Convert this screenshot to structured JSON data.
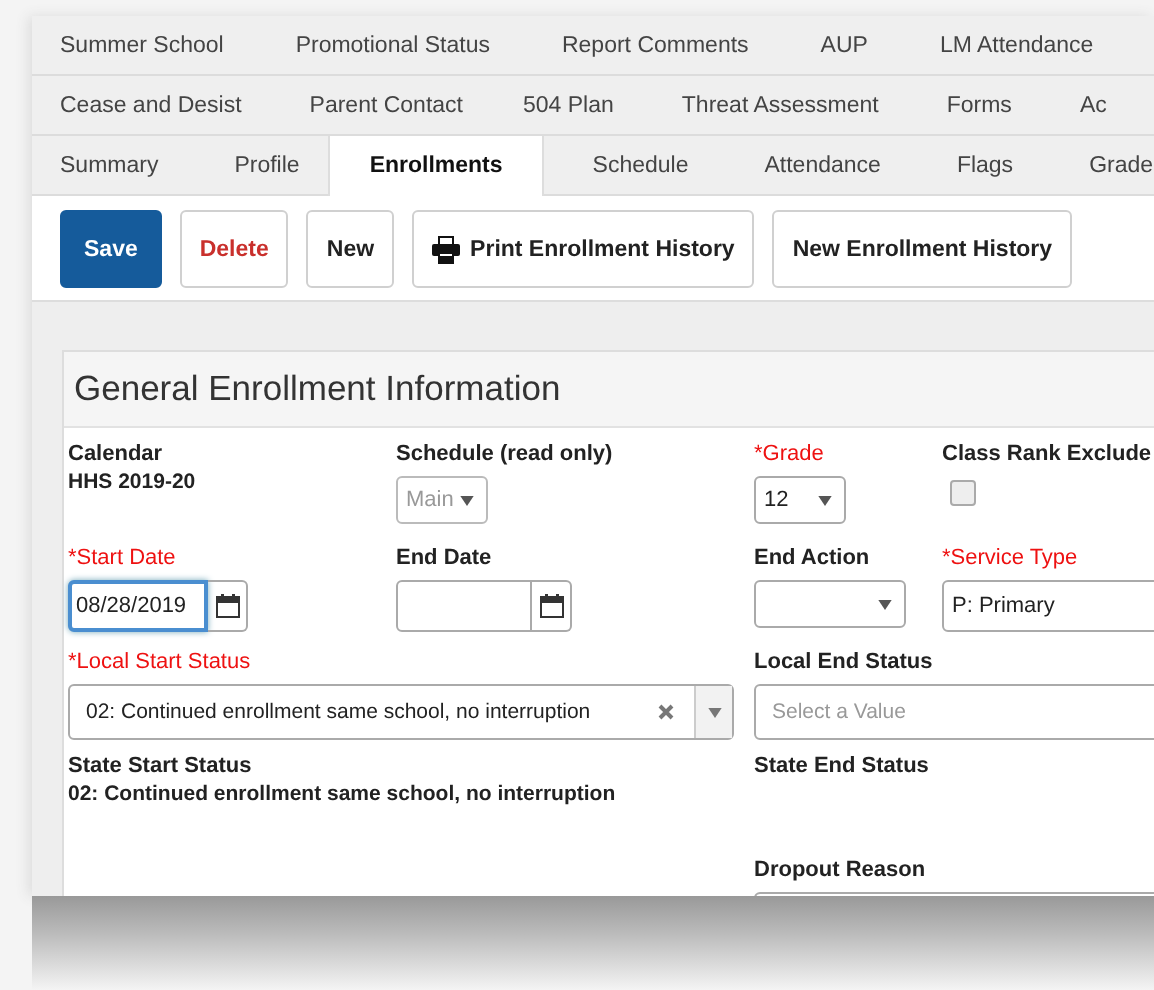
{
  "tab_rows": [
    [
      {
        "label": "Summer School",
        "selected": false
      },
      {
        "label": "Promotional Status",
        "selected": false
      },
      {
        "label": "Report Comments",
        "selected": false
      },
      {
        "label": "AUP",
        "selected": false
      },
      {
        "label": "LM Attendance",
        "selected": false
      }
    ],
    [
      {
        "label": "Cease and Desist",
        "selected": false
      },
      {
        "label": "Parent Contact",
        "selected": false
      },
      {
        "label": "504 Plan",
        "selected": false
      },
      {
        "label": "Threat Assessment",
        "selected": false
      },
      {
        "label": "Forms",
        "selected": false
      },
      {
        "label": "Ac",
        "selected": false
      }
    ],
    [
      {
        "label": "Summary",
        "selected": false
      },
      {
        "label": "Profile",
        "selected": false
      },
      {
        "label": "Enrollments",
        "selected": true
      },
      {
        "label": "Schedule",
        "selected": false
      },
      {
        "label": "Attendance",
        "selected": false
      },
      {
        "label": "Flags",
        "selected": false
      },
      {
        "label": "Grade",
        "selected": false
      }
    ]
  ],
  "toolbar": [
    {
      "label": "Save",
      "kind": "primary"
    },
    {
      "label": "Delete",
      "kind": "danger"
    },
    {
      "label": "New",
      "kind": "plain"
    },
    {
      "label": "Print Enrollment History",
      "kind": "print"
    },
    {
      "label": "New Enrollment History",
      "kind": "plain"
    }
  ],
  "panel": {
    "title": "General Enrollment Information",
    "fields": [
      {
        "kind": "readout",
        "label": "Calendar",
        "value": "HHS 2019-20",
        "required": false
      },
      {
        "kind": "select",
        "label": "Schedule (read only)",
        "value": "Main",
        "required": false,
        "disabled": true
      },
      {
        "kind": "select",
        "label": "*Grade",
        "value": "12",
        "required": true,
        "disabled": false
      },
      {
        "kind": "checkbox",
        "label": "Class Rank Exclude",
        "checked": false,
        "required": false
      },
      {
        "kind": "date",
        "label": "*Start Date",
        "value": "08/28/2019",
        "required": true,
        "focused": true
      },
      {
        "kind": "date",
        "label": "End Date",
        "required": false,
        "focused": false
      },
      {
        "kind": "select",
        "label": "End Action",
        "required": false,
        "disabled": false
      },
      {
        "kind": "input",
        "label": "*Service Type",
        "value": "P: Primary",
        "required": true
      },
      {
        "kind": "combo",
        "label": "*Local Start Status",
        "value": "02: Continued enrollment same school, no interruption",
        "required": true
      },
      {
        "kind": "combo",
        "label": "Local End Status",
        "placeholder": "Select a Value",
        "required": false
      },
      {
        "kind": "status",
        "label": "State Start Status",
        "value": "02: Continued enrollment same school, no interruption",
        "required": false
      },
      {
        "kind": "status",
        "label": "State End Status",
        "required": false
      },
      {
        "kind": "textarea",
        "label": "Dropout Reason",
        "required": false
      }
    ]
  }
}
